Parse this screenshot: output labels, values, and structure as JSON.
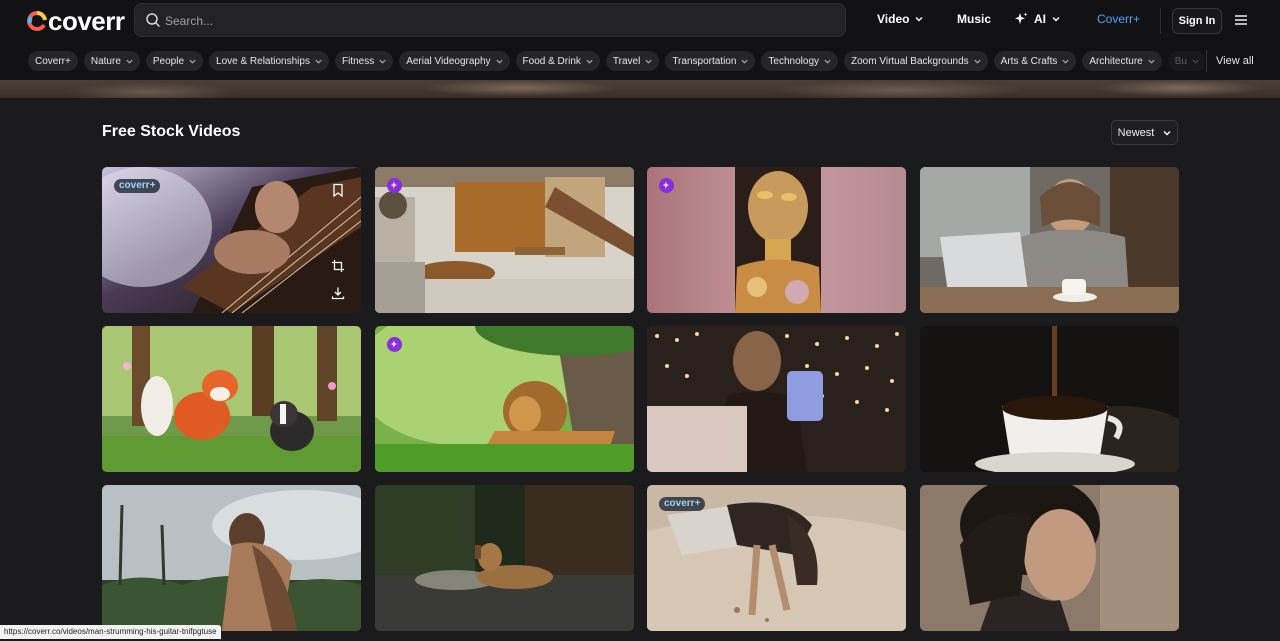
{
  "header": {
    "logo_text": "coverr",
    "search_placeholder": "Search...",
    "nav": [
      {
        "label": "Video",
        "has_menu": true
      },
      {
        "label": "Music",
        "has_menu": false
      },
      {
        "label": "AI",
        "has_menu": true,
        "icon": "sparkle-icon"
      },
      {
        "label": "Coverr+",
        "has_menu": false,
        "color": "#4aa8ff"
      }
    ],
    "signin_label": "Sign In",
    "menu_icon": "hamburger-menu-icon"
  },
  "categories": {
    "items": [
      "Coverr+",
      "Nature",
      "People",
      "Love & Relationships",
      "Fitness",
      "Aerial Videography",
      "Food & Drink",
      "Travel",
      "Transportation",
      "Technology",
      "Zoom Virtual Backgrounds",
      "Arts & Crafts",
      "Architecture",
      "Bu"
    ],
    "view_all_label": "View all"
  },
  "main": {
    "title": "Free Stock Videos",
    "sort_label": "Newest"
  },
  "videos": [
    {
      "badge": "coverr+",
      "subject": "guitar",
      "hover_tools": [
        "bookmark-icon",
        "crop-icon",
        "download-icon"
      ]
    },
    {
      "badge": "ai",
      "subject": "modern kitchen interior"
    },
    {
      "badge": "ai",
      "subject": "woman with golden face paint"
    },
    {
      "badge": "",
      "subject": "woman with laptop in cafe"
    },
    {
      "badge": "",
      "subject": "cartoon fox and skunk"
    },
    {
      "badge": "ai",
      "subject": "lion under tree"
    },
    {
      "badge": "",
      "subject": "woman with phone and lights"
    },
    {
      "badge": "",
      "subject": "coffee pouring"
    },
    {
      "badge": "",
      "subject": "woman on tropical beach"
    },
    {
      "badge": "",
      "subject": "dog lying on porch"
    },
    {
      "badge": "coverr+",
      "subject": "girl drawing in sand"
    },
    {
      "badge": "",
      "subject": "curly haired woman profile"
    }
  ],
  "status_url": "https://coverr.co/videos/man-strumming-his-guitar-tnifpgtuse",
  "badge_text": "coverr+",
  "colors": {
    "accent": "#4aa8ff",
    "ai_badge": "#8b2be2",
    "background": "#1b1b1d",
    "header": "#121214"
  }
}
